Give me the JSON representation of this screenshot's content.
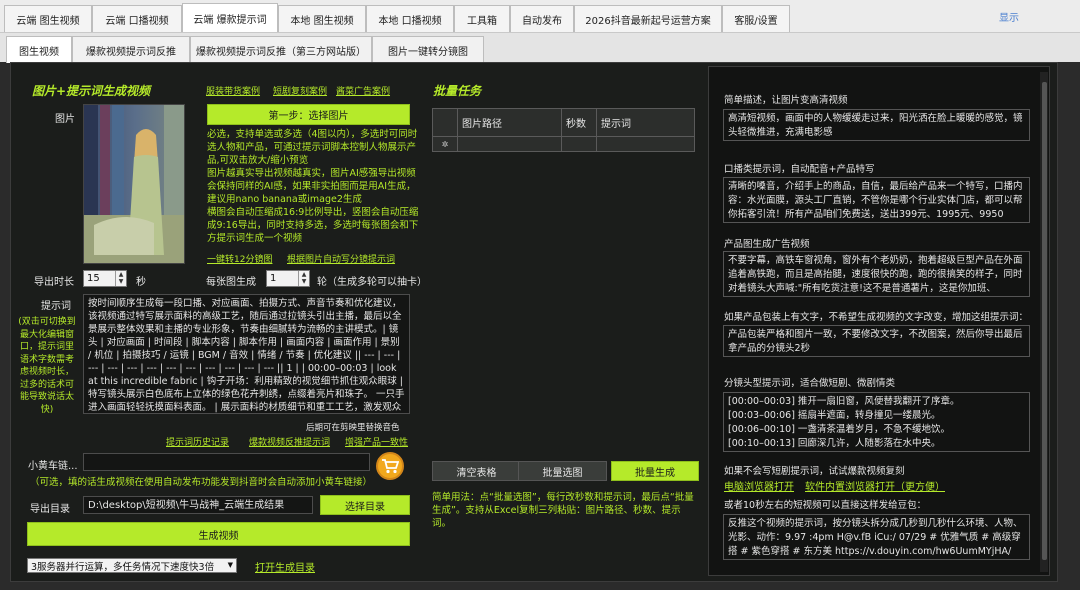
{
  "top_tabs": [
    {
      "label": "云端 图生视频"
    },
    {
      "label": "云端 口播视频"
    },
    {
      "label": "云端 爆款提示词"
    },
    {
      "label": "本地 图生视频"
    },
    {
      "label": "本地 口播视频"
    },
    {
      "label": "工具箱"
    },
    {
      "label": "自动发布"
    },
    {
      "label": "2026抖音最新起号运营方案"
    },
    {
      "label": "客服/设置"
    }
  ],
  "show_label": "显示",
  "sub_tabs": [
    {
      "label": "图生视频"
    },
    {
      "label": "爆款视频提示词反推"
    },
    {
      "label": "爆款视频提示词反推（第三方网站版）"
    },
    {
      "label": "图片一键转分镜图"
    }
  ],
  "left": {
    "heading": "图片+提示词生成视频",
    "case_links": [
      "服装带货案例",
      "短剧复刻案例",
      "酱菜广告案例"
    ],
    "image_label": "图片",
    "step1_button": "第一步：选择图片",
    "image_note": "必选，支持单选或多选（4图以内），多选时可同时选人物和产品，可通过提示词脚本控制人物展示产品,可双击放大/缩小预览\n图片越真实导出视频越真实，图片AI感强导出视频会保持同样的AI感，如果非实拍图而是用AI生成，建议用nano banana或image2生成\n横图会自动压缩成16:9比例导出，竖图会自动压缩成9:16导出，同时支持多选，多选时每张图会和下方提示词生成一个视频",
    "one_click_links": [
      "一键转12分镜图",
      "根据图片自动写分镜提示词"
    ],
    "duration_label": "导出时长",
    "duration_value": "15",
    "duration_unit": "秒",
    "per_image_label": "每张图生成",
    "per_image_value": "1",
    "per_image_unit": "轮（生成多轮可以抽卡）",
    "prompt_label": "提示词",
    "prompt_side_note": "(双击可切换到最大化编辑窗口，提示词里语术字数需考虑视频时长，过多的话术可能导致说话太快)",
    "prompt_text": "按时间顺序生成每一段口播、对应画面、拍摄方式、声音节奏和优化建议，该视频通过特写展示面料的高级工艺，随后通过拉镜头引出主播，最后以全景展示整体效果和主播的专业形象，节奏由细腻转为流畅的主讲模式。| 镜头 | 对应画面 | 时间段 | 脚本内容 | 脚本作用 | 画面内容 | 画面作用 | 景别 / 机位 | 拍摄技巧 / 运镜 | BGM / 音效 | 情绪 / 节奏 | 优化建议 || --- | --- | --- | --- | --- | --- | --- | --- | --- | --- | --- | --- || 1 | | 00:00–00:03 | look at this incredible fabric | 钩子开场：利用精致的视觉细节抓住观众眼球 | 特写镜头展示白色底布上立体的绿色花卉刺绣，点缀着亮片和珠子。 一只手进入画面轻轻抚摸面料表面。 | 展示面料的材质细节和重工工艺，激发观众购买欲",
    "prompt_links": [
      "提示词历史记录",
      "爆款视频反推提示词",
      "增强产品一致性"
    ],
    "prompt_hint": "后期可在剪映里替换音色",
    "cart_label": "小黄车链...",
    "cart_value": "",
    "cart_note": "（可选，填的话生成视频在使用自动发布功能发到抖音时会自动添加小黄车链接）",
    "export_dir_label": "导出目录",
    "export_dir_value": "D:\\desktop\\短视频\\牛马战神_云端生成结果",
    "choose_dir_button": "选择目录",
    "generate_button": "生成视频",
    "concurrency_value": "3服务器并行运算，多任务情况下速度快3倍",
    "open_dir_link": "打开生成目录"
  },
  "batch": {
    "heading": "批量任务",
    "columns": [
      "图片路径",
      "秒数",
      "提示词"
    ],
    "row_marker": "✲",
    "clear_button": "清空表格",
    "batch_select_button": "批量选图",
    "batch_generate_button": "批量生成",
    "usage_note": "简单用法：点“批量选图”，每行改秒数和提示词，最后点“批量生成”。支持从Excel复制三列粘贴：图片路径、秒数、提示词。"
  },
  "right": {
    "sections": [
      {
        "title": "简单描述，让图片变高清视频",
        "body": "高清短视频，画面中的人物缓缓走过来，阳光洒在脸上暖暖的感觉，镜头轻微推进，充满电影感"
      },
      {
        "title": "口播类提示词，自动配音+产品特写",
        "body": "清晰的嗓音，介绍手上的商品，自信，最后给产品来一个特写，口播内容：水光面膜，源头工厂直销，不管你是哪个行业实体门店，都可以帮你拓客引流！所有产品咱们免费送，送出399元、1995元、9950"
      },
      {
        "title": "产品图生成广告视频",
        "body": "不要字幕，高铁车窗视角，窗外有个老奶奶，抱着超级巨型产品在外面追着高铁跑，而且是高抬腿，速度很快的跑，跑的很搞笑的样子，同时对着镜头大声喊:\"所有吃货注意!这不是普通薯片，这是你加班、"
      },
      {
        "title": "如果产品包装上有文字，不希望生成视频的文字改变，增加这组提示词：",
        "body": "产品包装严格和图片一致，不要修改文字，不改图案，然后你导出最后拿产品的分镜头2秒"
      },
      {
        "title": "分镜头型提示词，适合做短剧、微剧情类",
        "body": "[00:00–00:03] 推开一扇旧窗，风便替我翻开了序章。\n[00:03–00:06] 摇扇半遮面，转身撞见一缕晨光。\n[00:06–00:10] 一盏清茶温着岁月，不急不缓地饮。\n[00:10–00:13] 回廊深几许，人随影落在水中央。"
      }
    ],
    "copy_title": "如果不会写短剧提示词，试试爆款视频复刻",
    "copy_links": [
      "电脑浏览器打开",
      "软件内置浏览器打开（更方便）"
    ],
    "douyin_title": "或者10秒左右的短视频可以直接这样发给豆包：",
    "douyin_body": "反推这个视频的提示词，按分镜头拆分成几秒到几秒什么环境、人物、光影、动作：9.97 :4pm H@v.fB iCu:/ 07/29 # 优雅气质 # 高级穿搭 # 紫色穿搭 # 东方美 https://v.douyin.com/hw6UumMYjHA/"
  },
  "colors": {
    "accent": "#b5ea2a",
    "panel": "#1b1d1b",
    "cart_orange": "#f2a81d"
  }
}
